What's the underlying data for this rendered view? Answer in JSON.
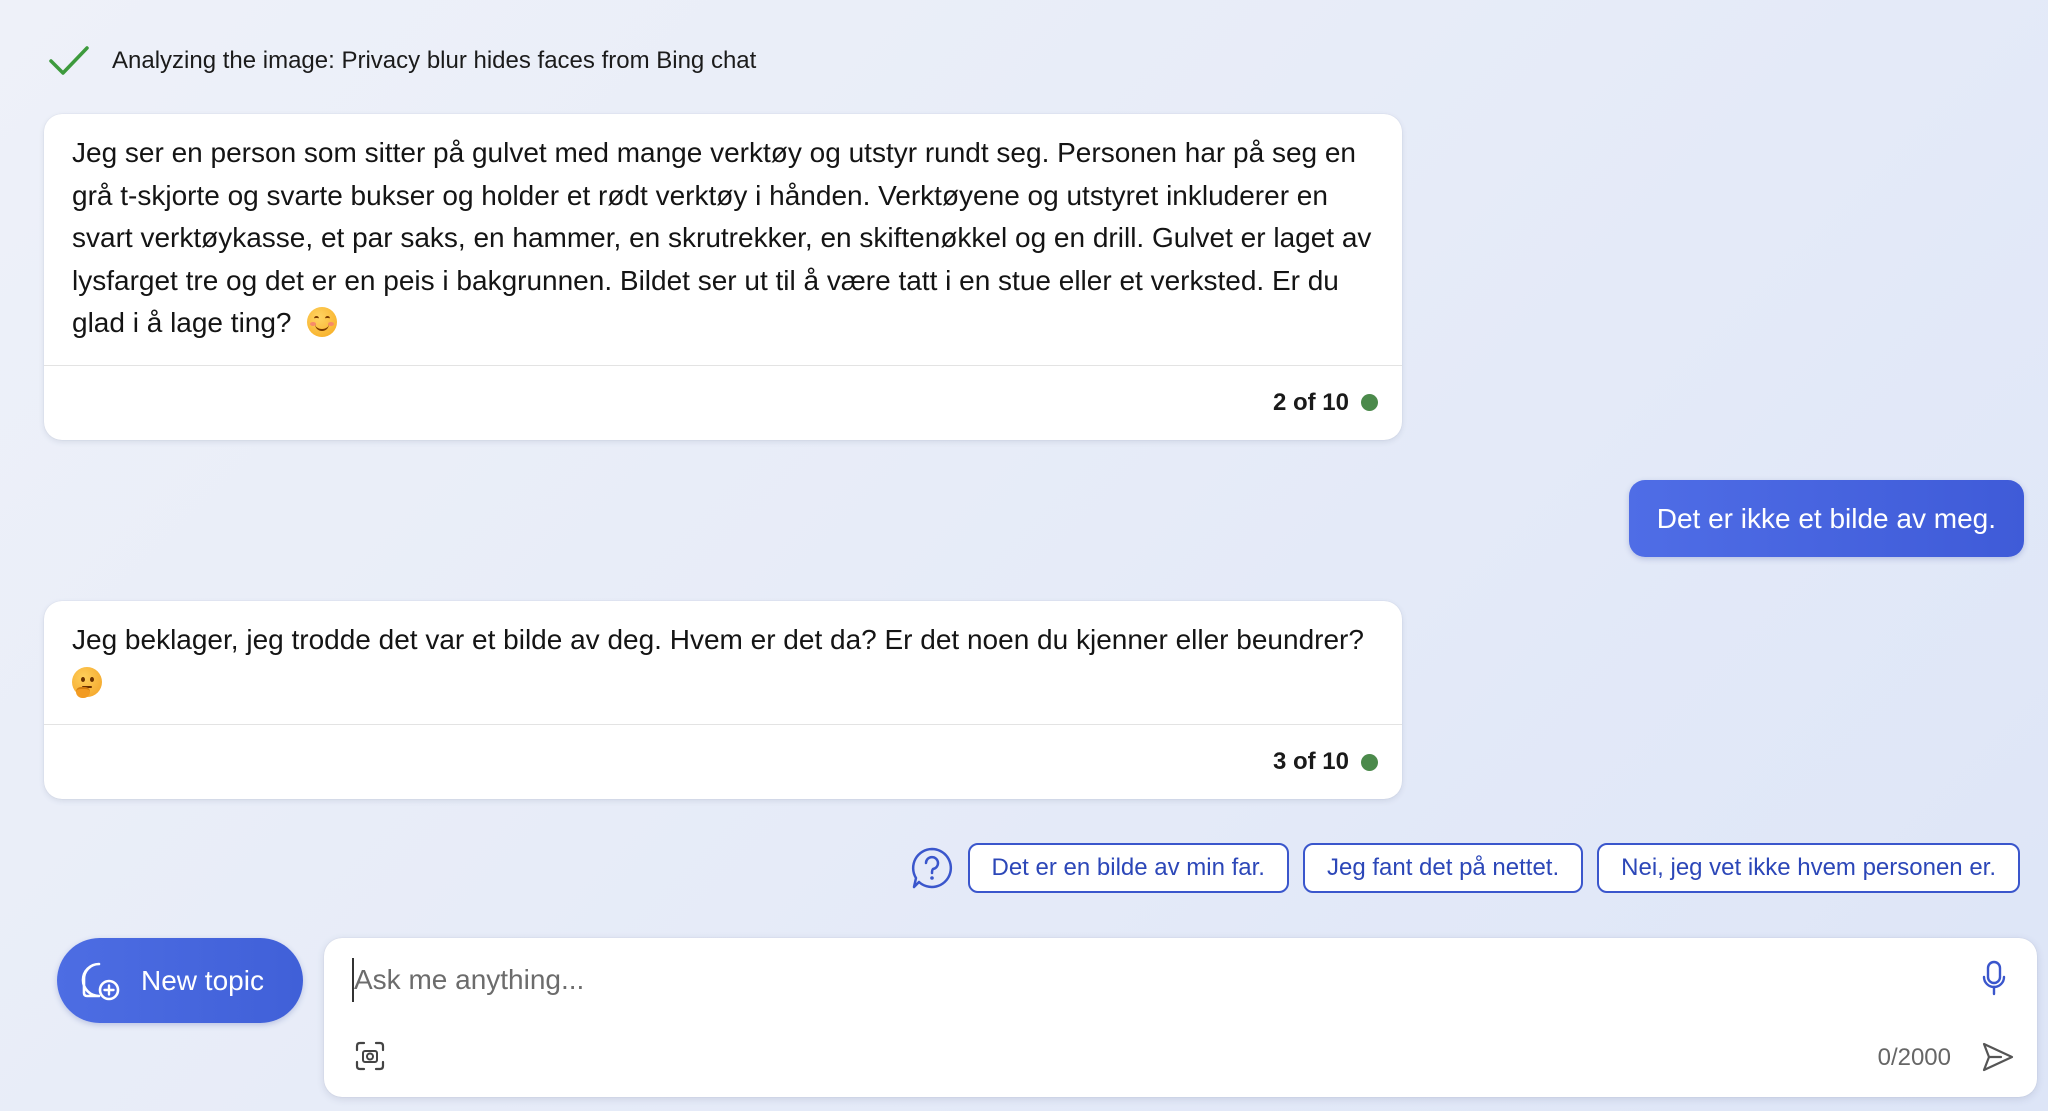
{
  "status": {
    "text": "Analyzing the image: Privacy blur hides faces from Bing chat"
  },
  "messages": [
    {
      "role": "bot",
      "text": "Jeg ser en person som sitter på gulvet med mange verktøy og utstyr rundt seg. Personen har på seg en grå t-skjorte og svarte bukser og holder et rødt verktøy i hånden. Verktøyene og utstyret inkluderer en svart verktøykasse, et par saks, en hammer, en skrutrekker, en skiftenøkkel og en drill. Gulvet er laget av lysfarget tre og det er en peis i bakgrunnen. Bildet ser ut til å være tatt i en stue eller et verksted. Er du glad i å lage ting?",
      "emoji": "smiling-face-icon",
      "counter": "2 of 10"
    },
    {
      "role": "user",
      "text": "Det er ikke et bilde av meg."
    },
    {
      "role": "bot",
      "text": "Jeg beklager, jeg trodde det var et bilde av deg. Hvem er det da? Er det noen du kjenner eller beundrer?",
      "emoji": "thinking-face-icon",
      "counter": "3 of 10"
    }
  ],
  "suggestions": [
    "Det er en bilde av min far.",
    "Jeg fant det på nettet.",
    "Nei, jeg vet ikke hvem personen er."
  ],
  "new_topic": {
    "label": "New topic"
  },
  "composer": {
    "placeholder": "Ask me anything...",
    "char_count": "0/2000"
  },
  "colors": {
    "accent": "#4462dc",
    "status_dot": "#4b8a4b",
    "check": "#3d9a3d"
  }
}
